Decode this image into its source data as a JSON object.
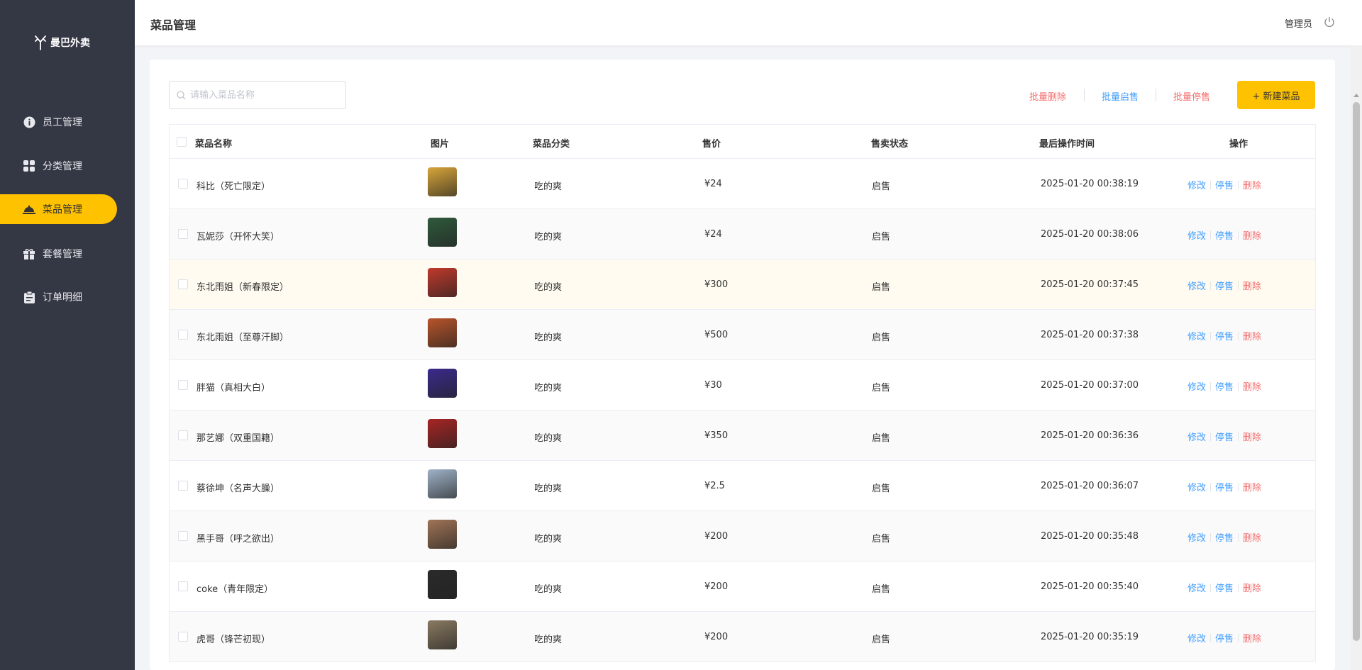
{
  "app": {
    "logo_text": "曼巴外卖"
  },
  "sidebar": {
    "items": [
      {
        "label": "员工管理",
        "icon": "info-circle-icon",
        "active": false
      },
      {
        "label": "分类管理",
        "icon": "grid-icon",
        "active": false
      },
      {
        "label": "菜品管理",
        "icon": "dish-cover-icon",
        "active": true
      },
      {
        "label": "套餐管理",
        "icon": "gift-icon",
        "active": false
      },
      {
        "label": "订单明细",
        "icon": "clipboard-icon",
        "active": false
      }
    ]
  },
  "header": {
    "title": "菜品管理",
    "user": "管理员",
    "logout_icon": "power-icon"
  },
  "toolbar": {
    "search_placeholder": "请输入菜品名称",
    "batch_delete": "批量删除",
    "batch_enable": "批量启售",
    "batch_disable": "批量停售",
    "new_button": "+ 新建菜品"
  },
  "table": {
    "columns": [
      "菜品名称",
      "图片",
      "菜品分类",
      "售价",
      "售卖状态",
      "最后操作时间",
      "操作"
    ],
    "rows": [
      {
        "name": "科比（死亡限定）",
        "category": "吃的爽",
        "price": "¥24",
        "status": "启售",
        "updated": "2025-01-20 00:38:19",
        "img_color": "#d8a53a"
      },
      {
        "name": "瓦妮莎（开怀大笑）",
        "category": "吃的爽",
        "price": "¥24",
        "status": "启售",
        "updated": "2025-01-20 00:38:06",
        "img_color": "#2f5a3c"
      },
      {
        "name": "东北雨姐（新春限定）",
        "category": "吃的爽",
        "price": "¥300",
        "status": "启售",
        "updated": "2025-01-20 00:37:45",
        "img_color": "#c0392b"
      },
      {
        "name": "东北雨姐（至尊汗脚）",
        "category": "吃的爽",
        "price": "¥500",
        "status": "启售",
        "updated": "2025-01-20 00:37:38",
        "img_color": "#b8542a"
      },
      {
        "name": "胖猫（真相大白）",
        "category": "吃的爽",
        "price": "¥30",
        "status": "启售",
        "updated": "2025-01-20 00:37:00",
        "img_color": "#3b2a8c"
      },
      {
        "name": "那艺娜（双重国籍）",
        "category": "吃的爽",
        "price": "¥350",
        "status": "启售",
        "updated": "2025-01-20 00:36:36",
        "img_color": "#a82424"
      },
      {
        "name": "蔡徐坤（名声大臊）",
        "category": "吃的爽",
        "price": "¥2.5",
        "status": "启售",
        "updated": "2025-01-20 00:36:07",
        "img_color": "#9fb3c8"
      },
      {
        "name": "黑手哥（呼之欲出）",
        "category": "吃的爽",
        "price": "¥200",
        "status": "启售",
        "updated": "2025-01-20 00:35:48",
        "img_color": "#a07456"
      },
      {
        "name": "coke（青年限定）",
        "category": "吃的爽",
        "price": "¥200",
        "status": "启售",
        "updated": "2025-01-20 00:35:40",
        "img_color": "#2a2a2a"
      },
      {
        "name": "虎哥（锋芒初现）",
        "category": "吃的爽",
        "price": "¥200",
        "status": "启售",
        "updated": "2025-01-20 00:35:19",
        "img_color": "#8a7a62"
      }
    ],
    "actions": {
      "edit": "修改",
      "disable": "停售",
      "delete": "删除"
    }
  }
}
